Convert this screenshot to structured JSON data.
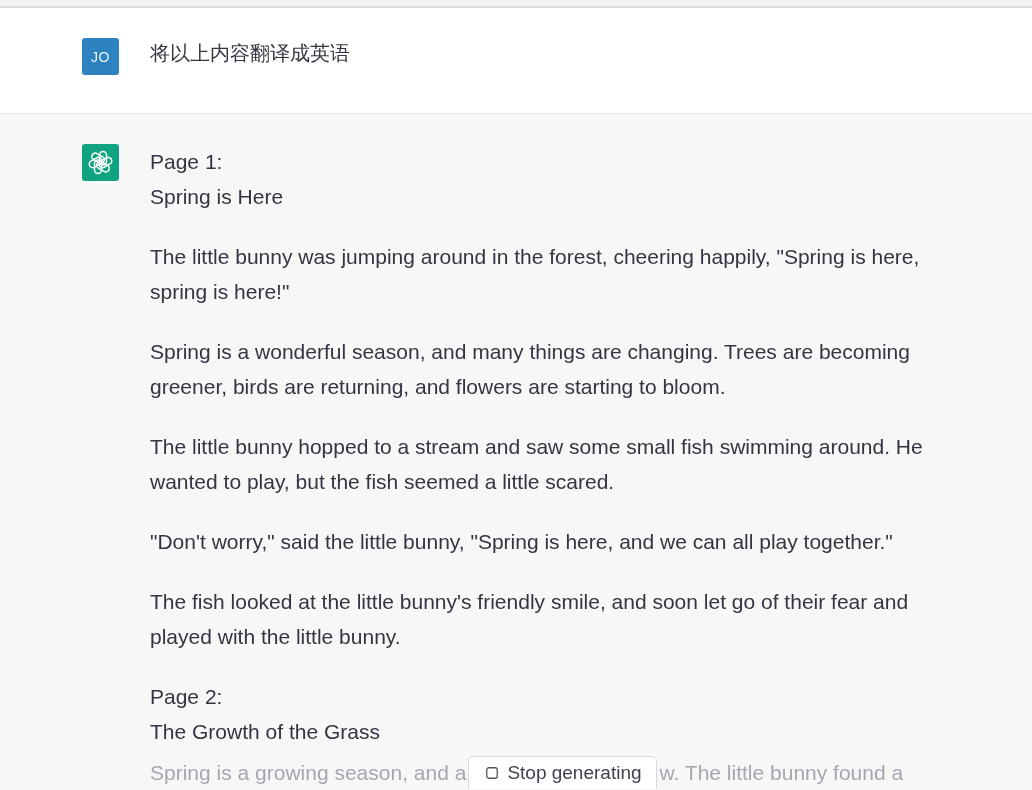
{
  "conversation": [
    {
      "kind": "user",
      "avatar": "JO",
      "paragraphs": [
        {
          "kind": "paragraph",
          "text": "将以上内容翻译成英语"
        }
      ]
    },
    {
      "kind": "assistant",
      "paragraphs": [
        {
          "kind": "heading",
          "lines": [
            "Page 1:",
            "Spring is Here"
          ]
        },
        {
          "kind": "paragraph",
          "text": "The little bunny was jumping around in the forest, cheering happily, \"Spring is here, spring is here!\""
        },
        {
          "kind": "paragraph",
          "text": "Spring is a wonderful season, and many things are changing. Trees are becoming greener, birds are returning, and flowers are starting to bloom."
        },
        {
          "kind": "paragraph",
          "text": "The little bunny hopped to a stream and saw some small fish swimming around. He wanted to play, but the fish seemed a little scared."
        },
        {
          "kind": "paragraph",
          "text": "\"Don't worry,\" said the little bunny, \"Spring is here, and we can all play together.\""
        },
        {
          "kind": "paragraph",
          "text": "The fish looked at the little bunny's friendly smile, and soon let go of their fear and played with the little bunny."
        },
        {
          "kind": "heading",
          "lines": [
            "Page 2:",
            "The Growth of the Grass"
          ]
        },
        {
          "kind": "faded",
          "parts": [
            "Spring is a growing season, and a",
            "w. The little bunny found a"
          ]
        }
      ]
    }
  ],
  "stop_button": {
    "label": "Stop generating"
  }
}
